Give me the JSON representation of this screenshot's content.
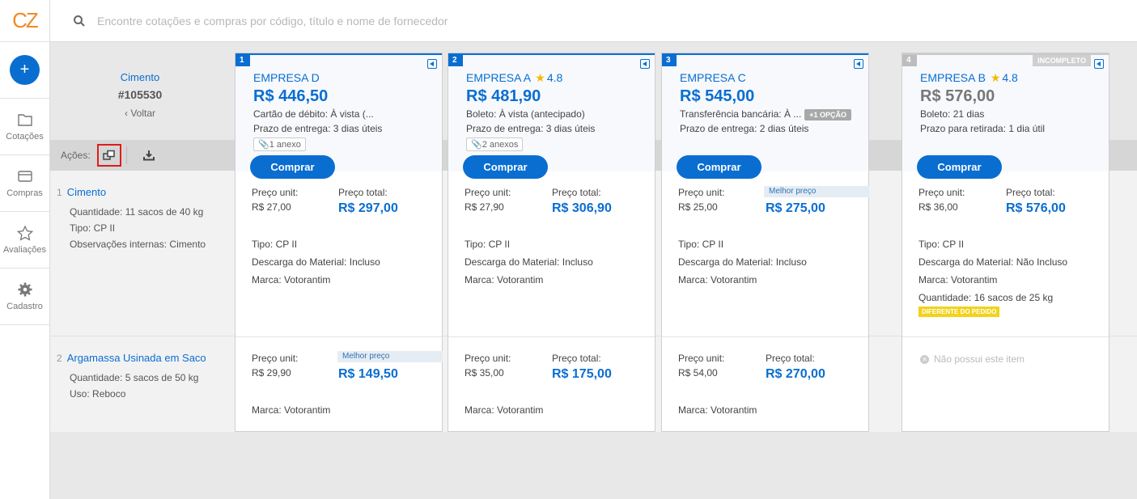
{
  "logo": "CZ",
  "search": {
    "placeholder": "Encontre cotações e compras por código, título e nome de fornecedor"
  },
  "sidebar": {
    "add_label": "+",
    "items": [
      {
        "label": "Cotações",
        "icon": "folder-icon"
      },
      {
        "label": "Compras",
        "icon": "card-icon"
      },
      {
        "label": "Avaliações",
        "icon": "star-icon"
      },
      {
        "label": "Cadastro",
        "icon": "gear-icon"
      }
    ]
  },
  "quote": {
    "title": "Cimento",
    "id": "#105530",
    "back": "‹ Voltar"
  },
  "actions": {
    "label": "Ações:"
  },
  "items": [
    {
      "num": "1",
      "name": "Cimento",
      "lines": [
        {
          "k": "Quantidade:",
          "v": "11 sacos de 40 kg"
        },
        {
          "k": "Tipo:",
          "v": "CP II"
        },
        {
          "k": "Observações internas:",
          "v": "Cimento"
        }
      ]
    },
    {
      "num": "2",
      "name": "Argamassa Usinada em Saco",
      "lines": [
        {
          "k": "Quantidade:",
          "v": "5 sacos de 50 kg"
        },
        {
          "k": "Uso:",
          "v": "Reboco"
        }
      ]
    }
  ],
  "labels": {
    "unit": "Preço unit:",
    "total": "Preço total:",
    "best": "Melhor preço",
    "buy": "Comprar",
    "type": "Tipo:",
    "discharge": "Descarga do Material:",
    "brand": "Marca:",
    "qty": "Quantidade:",
    "diff": "DIFERENTE DO PEDIDO",
    "no_item": "Não possui este item",
    "incomplete": "INCOMPLETO"
  },
  "cards": [
    {
      "num": "1",
      "company": "EMPRESA D",
      "rating": "",
      "price": "R$ 446,50",
      "payment": "Cartão de débito: À vista (...",
      "option": "",
      "delivery": "Prazo de entrega: 3 dias úteis",
      "attach": "1 anexo",
      "i1": {
        "unit": "R$ 27,00",
        "total": "R$ 297,00",
        "type": "CP II",
        "discharge": "Incluso",
        "brand": "Votorantim"
      },
      "i2": {
        "unit": "R$ 29,90",
        "total": "R$ 149,50",
        "brand": "Votorantim"
      }
    },
    {
      "num": "2",
      "company": "EMPRESA A",
      "rating": "4.8",
      "price": "R$ 481,90",
      "payment": "Boleto: À vista (antecipado)",
      "option": "",
      "delivery": "Prazo de entrega: 3 dias úteis",
      "attach": "2 anexos",
      "i1": {
        "unit": "R$ 27,90",
        "total": "R$ 306,90",
        "type": "CP II",
        "discharge": "Incluso",
        "brand": "Votorantim"
      },
      "i2": {
        "unit": "R$ 35,00",
        "total": "R$ 175,00",
        "brand": "Votorantim"
      }
    },
    {
      "num": "3",
      "company": "EMPRESA C",
      "rating": "",
      "price": "R$ 545,00",
      "payment": "Transferência bancária: À ...",
      "option": "+1 OPÇÃO",
      "delivery": "Prazo de entrega: 2 dias úteis",
      "attach": "",
      "i1": {
        "unit": "R$ 25,00",
        "total": "R$ 275,00",
        "type": "CP II",
        "discharge": "Incluso",
        "brand": "Votorantim"
      },
      "i2": {
        "unit": "R$ 54,00",
        "total": "R$ 270,00",
        "brand": "Votorantim"
      }
    },
    {
      "num": "4",
      "company": "EMPRESA B",
      "rating": "4.8",
      "price": "R$ 576,00",
      "payment": "Boleto: 21 dias",
      "option": "",
      "delivery": "Prazo para retirada: 1 dia útil",
      "attach": "",
      "i1": {
        "unit": "R$ 36,00",
        "total": "R$ 576,00",
        "type": "CP II",
        "discharge": "Não Incluso",
        "brand": "Votorantim",
        "qty": "16 sacos de 25 kg"
      }
    }
  ],
  "colors": {
    "primary": "#0a6ed1",
    "accent_logo": "#f08a24",
    "highlight_border": "#e01b1b",
    "warning": "#f2d21b"
  }
}
